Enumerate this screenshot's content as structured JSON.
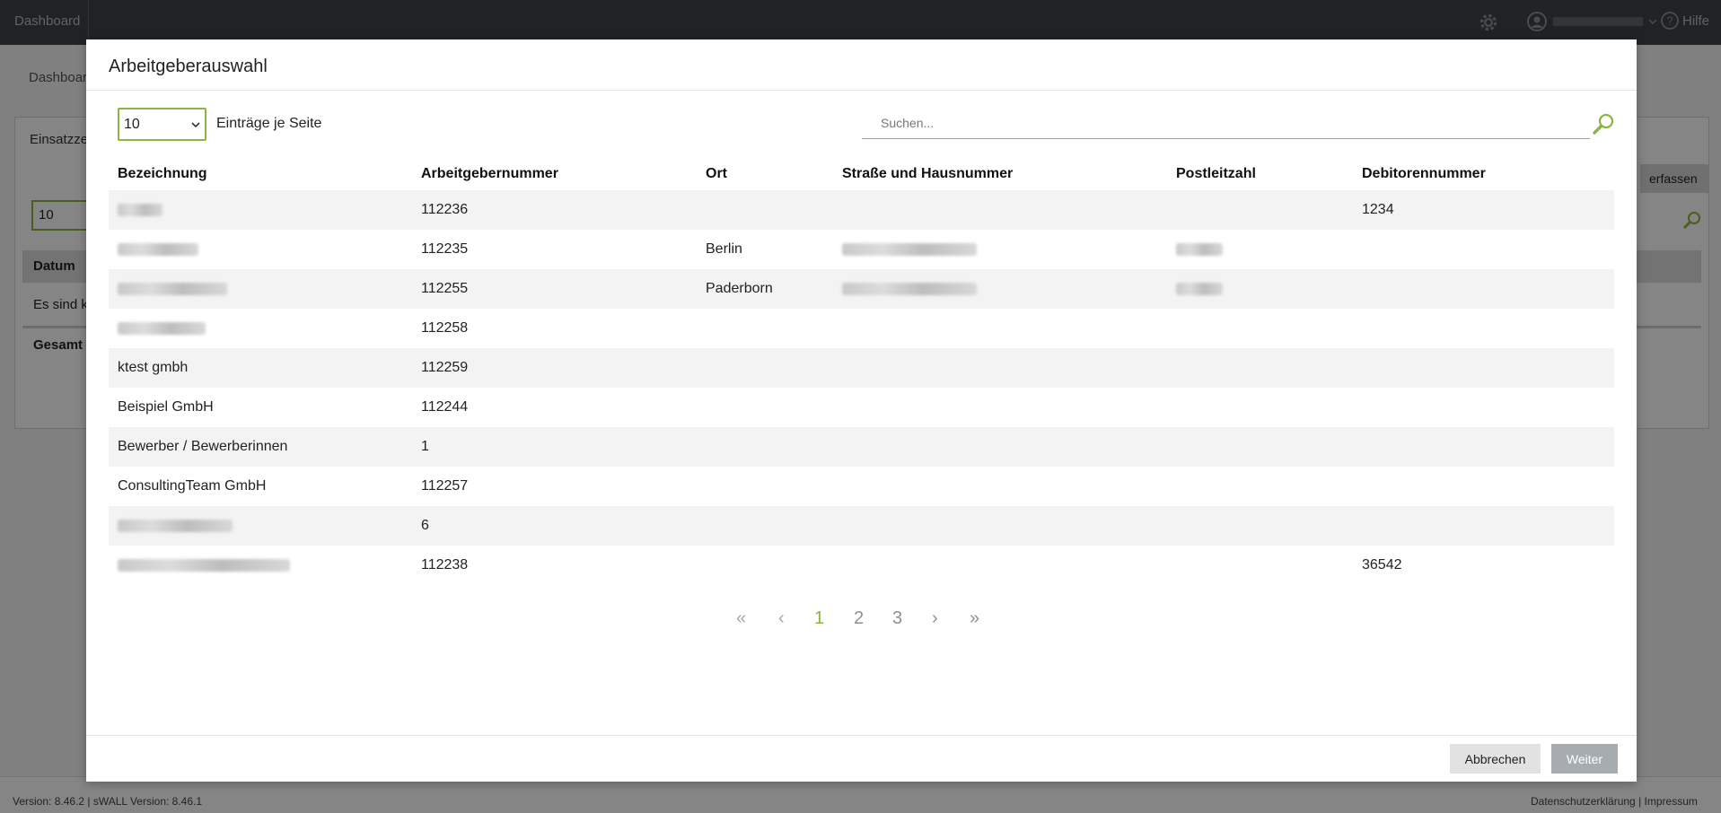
{
  "topbar": {
    "dashboard_label": "Dashboard",
    "help_label": "Hilfe"
  },
  "background": {
    "breadcrumb": "Dashboard",
    "panel_title": "Einsatzze",
    "page_length": "10",
    "column_date": "Datum",
    "empty_text": "Es sind k",
    "total_label": "Gesamt",
    "create_button": "erfassen"
  },
  "modal": {
    "title": "Arbeitgeberauswahl",
    "page_length_value": "10",
    "page_length_label": "Einträge je Seite",
    "search_placeholder": "Suchen...",
    "columns": [
      "Bezeichnung",
      "Arbeitgebernummer",
      "Ort",
      "Straße und Hausnummer",
      "Postleitzahl",
      "Debitorennummer"
    ],
    "rows": [
      {
        "name": "",
        "number": "112236",
        "city": "",
        "street": "",
        "zip": "",
        "debtor": "1234"
      },
      {
        "name": "",
        "number": "112235",
        "city": "Berlin",
        "street": "",
        "zip": "",
        "debtor": ""
      },
      {
        "name": "",
        "number": "112255",
        "city": "Paderborn",
        "street": "",
        "zip": "",
        "debtor": ""
      },
      {
        "name": "",
        "number": "112258",
        "city": "",
        "street": "",
        "zip": "",
        "debtor": ""
      },
      {
        "name": "ktest gmbh",
        "number": "112259",
        "city": "",
        "street": "",
        "zip": "",
        "debtor": ""
      },
      {
        "name": "Beispiel GmbH",
        "number": "112244",
        "city": "",
        "street": "",
        "zip": "",
        "debtor": ""
      },
      {
        "name": "Bewerber / Bewerberinnen",
        "number": "1",
        "city": "",
        "street": "",
        "zip": "",
        "debtor": ""
      },
      {
        "name": "ConsultingTeam GmbH",
        "number": "112257",
        "city": "",
        "street": "",
        "zip": "",
        "debtor": ""
      },
      {
        "name": "",
        "number": "6",
        "city": "",
        "street": "",
        "zip": "",
        "debtor": ""
      },
      {
        "name": "",
        "number": "112238",
        "city": "",
        "street": "",
        "zip": "",
        "debtor": "36542"
      }
    ],
    "pagination": {
      "first": "«",
      "prev": "‹",
      "pages": [
        "1",
        "2",
        "3"
      ],
      "current_page": "1",
      "next": "›",
      "last": "»"
    },
    "cancel_label": "Abbrechen",
    "next_label": "Weiter"
  },
  "footer": {
    "version_text": "Version: 8.46.2 |  sWALL Version: 8.46.1",
    "privacy_label": "Datenschutzerklärung",
    "imprint_label": "Impressum"
  },
  "colors": {
    "accent": "#8ab63f",
    "topbar": "#3d4448",
    "disabled_button": "#a6acb0"
  }
}
